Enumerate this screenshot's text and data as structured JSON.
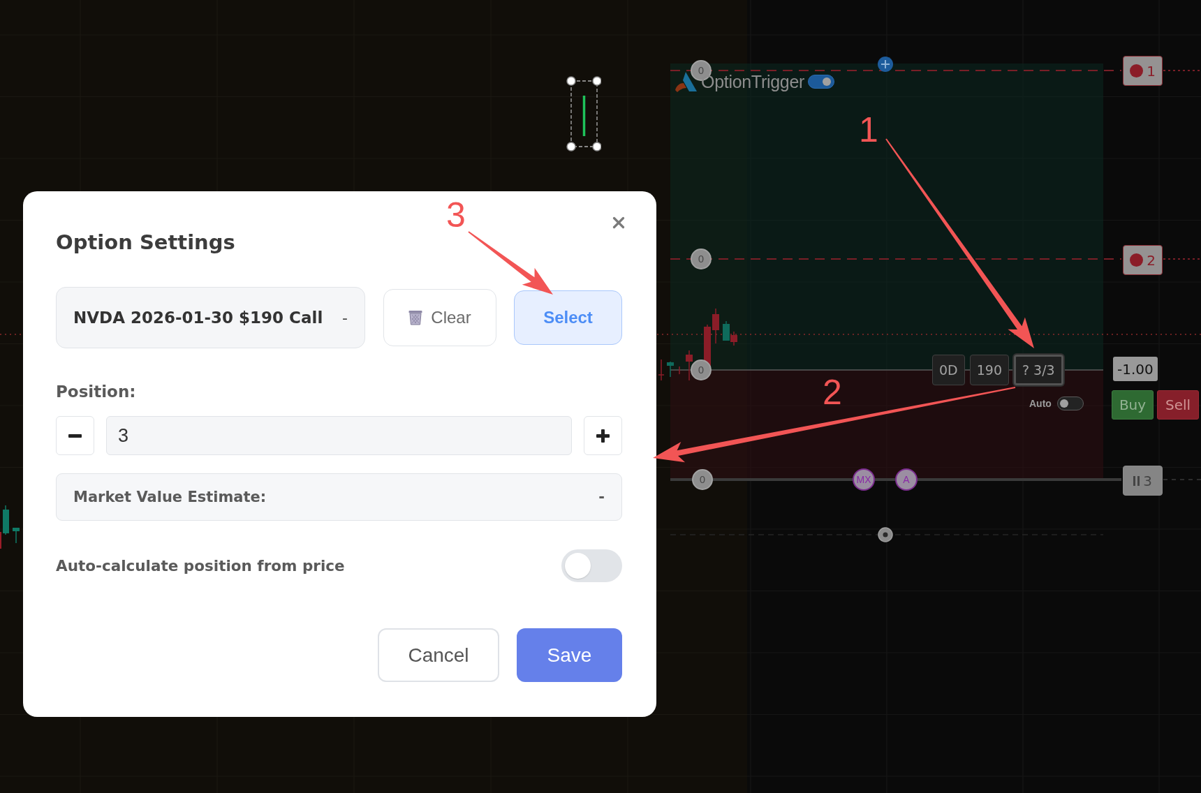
{
  "chart": {
    "brand": {
      "name": "OptionTrigger",
      "enabled": true
    },
    "level_handles": [
      {
        "label": "0"
      },
      {
        "label": "0"
      },
      {
        "label": "0"
      },
      {
        "label": "0"
      }
    ],
    "price_tags": [
      {
        "label": "1",
        "kind": "stop"
      },
      {
        "label": "2",
        "kind": "stop"
      },
      {
        "label": "3",
        "kind": "paused"
      }
    ],
    "order_chips": [
      {
        "label": "0D",
        "selected": false
      },
      {
        "label": "190",
        "selected": false
      },
      {
        "label": "? 3/3",
        "selected": true
      }
    ],
    "auto": {
      "label": "Auto",
      "on": false
    },
    "quantity": "-1.00",
    "trade_buttons": [
      {
        "label": "Buy",
        "kind": "buy"
      },
      {
        "label": "Sell",
        "kind": "sell"
      }
    ],
    "markers": [
      {
        "label": "MX"
      },
      {
        "label": "A"
      }
    ]
  },
  "dialog": {
    "title": "Option Settings",
    "contract": {
      "value": "NVDA 2026-01-30 $190 Call",
      "price": "-"
    },
    "clear_button": "Clear",
    "select_button": "Select",
    "position": {
      "label": "Position:",
      "value": "3"
    },
    "market_value": {
      "label": "Market Value Estimate:",
      "value": "-"
    },
    "auto_calculate": {
      "label": "Auto-calculate position from price",
      "on": false
    },
    "buttons": [
      {
        "label": "Cancel",
        "kind": "cancel"
      },
      {
        "label": "Save",
        "kind": "save"
      }
    ]
  },
  "annotations": [
    {
      "label": "1"
    },
    {
      "label": "2"
    },
    {
      "label": "3"
    }
  ]
}
